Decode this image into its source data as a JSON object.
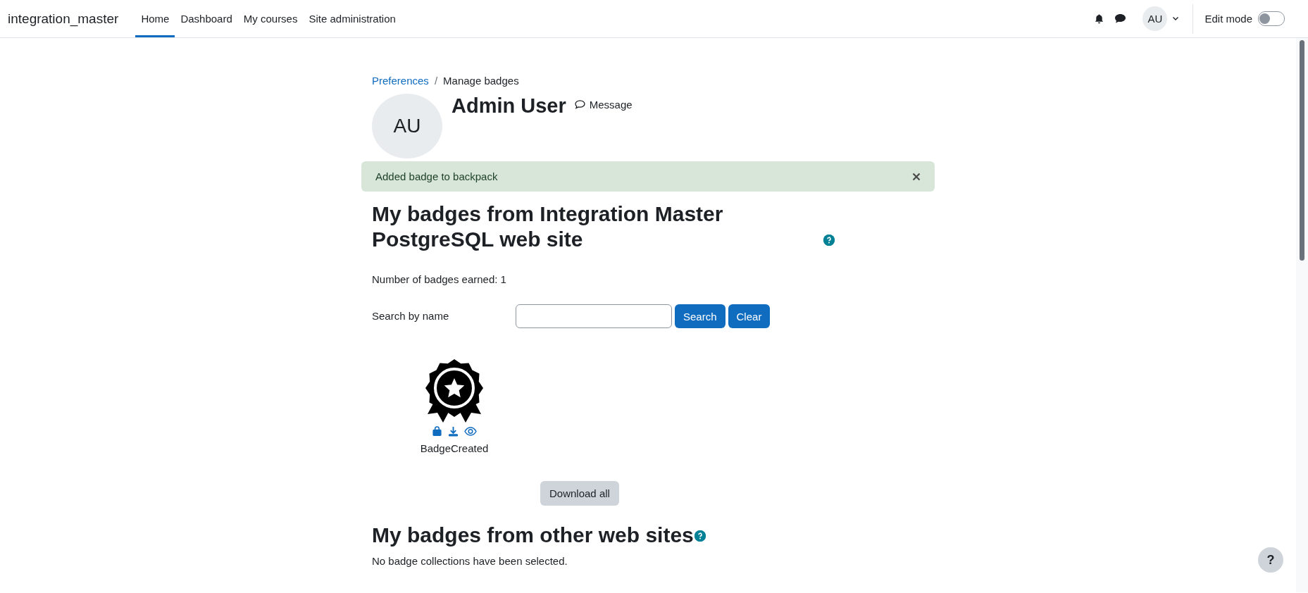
{
  "navbar": {
    "site_name": "integration_master",
    "items": [
      {
        "label": "Home",
        "selected": true
      },
      {
        "label": "Dashboard",
        "selected": false
      },
      {
        "label": "My courses",
        "selected": false
      },
      {
        "label": "Site administration",
        "selected": false
      }
    ],
    "user_initials": "AU",
    "edit_mode": {
      "label": "Edit mode",
      "on": false
    }
  },
  "breadcrumb": {
    "separator": "/",
    "items": [
      {
        "label": "Preferences",
        "kind": "link"
      },
      {
        "label": "Manage badges",
        "kind": "current"
      }
    ]
  },
  "profile": {
    "initials": "AU",
    "name": "Admin User",
    "message_label": "Message"
  },
  "alert": {
    "text": "Added badge to backpack"
  },
  "local_section": {
    "title": "My badges from Integration Master PostgreSQL web site",
    "count_text": "Number of badges earned: 1",
    "search": {
      "label": "Search by name",
      "buttons": [
        "Search",
        "Clear"
      ]
    },
    "badges": [
      {
        "name": "BadgeCreated"
      }
    ],
    "download_all": "Download all"
  },
  "other_section": {
    "title": "My badges from other web sites",
    "text": "No badge collections have been selected."
  },
  "help_button": "?"
}
